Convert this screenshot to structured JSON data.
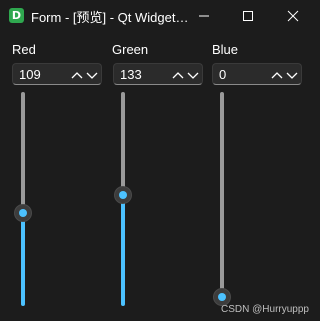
{
  "window": {
    "title": "Form - [预览] - Qt Widget…",
    "icon_letter": "D",
    "icon_color": "#2fa84f"
  },
  "channels": [
    {
      "label": "Red",
      "value": "109",
      "slider_fraction": 0.43
    },
    {
      "label": "Green",
      "value": "133",
      "slider_fraction": 0.52
    },
    {
      "label": "Blue",
      "value": "0",
      "slider_fraction": 0.0
    }
  ],
  "slider": {
    "min": 0,
    "max": 255
  },
  "colors": {
    "accent": "#4cc2ff",
    "groove": "#9a9a9a",
    "background": "#1c1c1c"
  },
  "watermark": "CSDN @Hurryuppp"
}
